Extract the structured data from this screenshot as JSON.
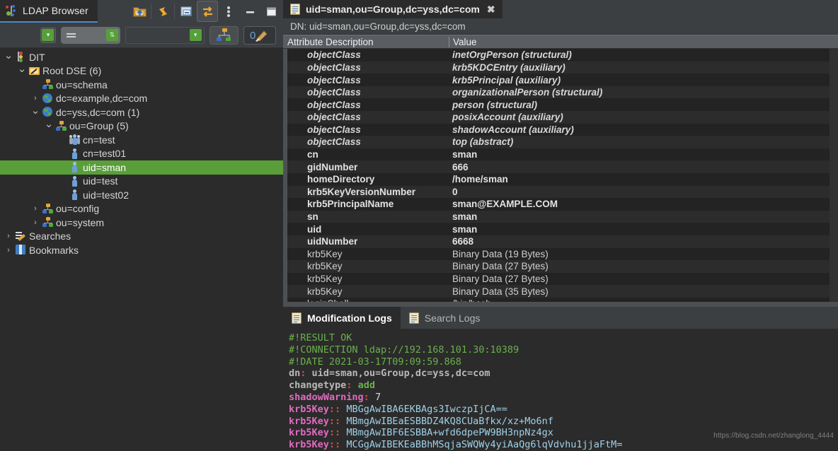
{
  "window": {
    "browser_tab_title": "LDAP Browser",
    "toolbar_buttons": [
      {
        "name": "open-connection-icon",
        "glyph": "folder-up"
      },
      {
        "name": "refresh-icon",
        "glyph": "refresh"
      },
      {
        "name": "collapse-all-icon",
        "glyph": "collapse"
      },
      {
        "name": "link-with-editor-icon",
        "glyph": "sync-arrows",
        "active": true
      },
      {
        "name": "view-menu-icon",
        "glyph": "kebab"
      },
      {
        "name": "minimize-icon",
        "glyph": "minus"
      },
      {
        "name": "maximize-icon",
        "glyph": "square"
      }
    ]
  },
  "filter_bar": {
    "operator_value": "=",
    "attribute_value": "",
    "value_value": "",
    "buttons": [
      {
        "name": "show-subtree-button",
        "glyph": "org-tree"
      },
      {
        "name": "quick-filter-button",
        "glyph": "filter-brush"
      }
    ]
  },
  "tree": {
    "items": [
      {
        "label": "DIT",
        "depth": 0,
        "arrow": "down",
        "icon": "dit-icon",
        "selected": false
      },
      {
        "label": "Root DSE (6)",
        "depth": 1,
        "arrow": "down",
        "icon": "root-dse-icon",
        "selected": false
      },
      {
        "label": "ou=schema",
        "depth": 2,
        "arrow": "none",
        "icon": "ou-icon",
        "selected": false
      },
      {
        "label": "dc=example,dc=com",
        "depth": 2,
        "arrow": "right",
        "icon": "domain-icon",
        "selected": false
      },
      {
        "label": "dc=yss,dc=com (1)",
        "depth": 2,
        "arrow": "down",
        "icon": "domain-icon",
        "selected": false
      },
      {
        "label": "ou=Group (5)",
        "depth": 3,
        "arrow": "down",
        "icon": "ou-icon",
        "selected": false
      },
      {
        "label": "cn=test",
        "depth": 4,
        "arrow": "none",
        "icon": "group-icon",
        "selected": false
      },
      {
        "label": "cn=test01",
        "depth": 4,
        "arrow": "none",
        "icon": "person-icon",
        "selected": false
      },
      {
        "label": "uid=sman",
        "depth": 4,
        "arrow": "none",
        "icon": "person-icon",
        "selected": true
      },
      {
        "label": "uid=test",
        "depth": 4,
        "arrow": "none",
        "icon": "person-icon",
        "selected": false
      },
      {
        "label": "uid=test02",
        "depth": 4,
        "arrow": "none",
        "icon": "person-icon",
        "selected": false
      },
      {
        "label": "ou=config",
        "depth": 2,
        "arrow": "right",
        "icon": "ou-icon",
        "selected": false
      },
      {
        "label": "ou=system",
        "depth": 2,
        "arrow": "right",
        "icon": "ou-icon",
        "selected": false
      },
      {
        "label": "Searches",
        "depth": 0,
        "arrow": "right",
        "icon": "searches-icon",
        "selected": false
      },
      {
        "label": "Bookmarks",
        "depth": 0,
        "arrow": "right",
        "icon": "bookmarks-icon",
        "selected": false
      }
    ],
    "selection_color": "#5a9e3a"
  },
  "entry_editor": {
    "tab_label": "uid=sman,ou=Group,dc=yss,dc=com",
    "tab_close_label": "✖",
    "dn_line": "DN: uid=sman,ou=Group,dc=yss,dc=com",
    "columns": [
      "Attribute Description",
      "Value"
    ],
    "rows": [
      {
        "attr": "objectClass",
        "value": "inetOrgPerson (structural)",
        "style": "oc"
      },
      {
        "attr": "objectClass",
        "value": "krb5KDCEntry (auxiliary)",
        "style": "oc"
      },
      {
        "attr": "objectClass",
        "value": "krb5Principal (auxiliary)",
        "style": "oc"
      },
      {
        "attr": "objectClass",
        "value": "organizationalPerson (structural)",
        "style": "oc"
      },
      {
        "attr": "objectClass",
        "value": "person (structural)",
        "style": "oc"
      },
      {
        "attr": "objectClass",
        "value": "posixAccount (auxiliary)",
        "style": "oc"
      },
      {
        "attr": "objectClass",
        "value": "shadowAccount (auxiliary)",
        "style": "oc"
      },
      {
        "attr": "objectClass",
        "value": "top (abstract)",
        "style": "oc"
      },
      {
        "attr": "cn",
        "value": "sman",
        "style": "bold"
      },
      {
        "attr": "gidNumber",
        "value": "666",
        "style": "bold"
      },
      {
        "attr": "homeDirectory",
        "value": "/home/sman",
        "style": "bold"
      },
      {
        "attr": "krb5KeyVersionNumber",
        "value": "0",
        "style": "bold"
      },
      {
        "attr": "krb5PrincipalName",
        "value": "sman@EXAMPLE.COM",
        "style": "bold"
      },
      {
        "attr": "sn",
        "value": "sman",
        "style": "bold"
      },
      {
        "attr": "uid",
        "value": "sman",
        "style": "bold"
      },
      {
        "attr": "uidNumber",
        "value": "6668",
        "style": "bold"
      },
      {
        "attr": "krb5Key",
        "value": "Binary Data (19 Bytes)",
        "style": "plain"
      },
      {
        "attr": "krb5Key",
        "value": "Binary Data (27 Bytes)",
        "style": "plain"
      },
      {
        "attr": "krb5Key",
        "value": "Binary Data (27 Bytes)",
        "style": "plain"
      },
      {
        "attr": "krb5Key",
        "value": "Binary Data (35 Bytes)",
        "style": "plain"
      },
      {
        "attr": "loginShell",
        "value": "/bin/bash",
        "style": "plain"
      }
    ]
  },
  "logs": {
    "tabs": [
      {
        "label": "Modification Logs",
        "active": true,
        "icon": "log-icon"
      },
      {
        "label": "Search Logs",
        "active": false,
        "icon": "log-icon"
      }
    ],
    "lines": [
      {
        "type": "comment",
        "text": "#!RESULT OK"
      },
      {
        "type": "comment",
        "text": "#!CONNECTION ldap://192.168.101.30:10389"
      },
      {
        "type": "comment",
        "text": "#!DATE 2021-03-17T09:09:59.868"
      },
      {
        "type": "kv_gray",
        "key": "dn",
        "value": "uid=sman,ou=Group,dc=yss,dc=com"
      },
      {
        "type": "kv_changetype",
        "key": "changetype",
        "value": "add"
      },
      {
        "type": "kv_attr",
        "key": "shadowWarning",
        "value": "7"
      },
      {
        "type": "kv_b64",
        "key": "krb5Key",
        "value": "MBGgAwIBA6EKBAgs3IwczpIjCA=="
      },
      {
        "type": "kv_b64",
        "key": "krb5Key",
        "value": "MBmgAwIBEaESBBDZ4KQ8CUaBfkx/xz+Mo6nf"
      },
      {
        "type": "kv_b64",
        "key": "krb5Key",
        "value": "MBmgAwIBF6ESBBA+wfd6dpePW9BH3npNz4gx"
      },
      {
        "type": "kv_b64",
        "key": "krb5Key",
        "value": "MCGgAwIBEKEaBBhMSqjaSWQWy4yiAaQg6lqVdvhu1jjaFtM="
      }
    ]
  },
  "watermark": "https://blog.csdn.net/zhanglong_4444"
}
